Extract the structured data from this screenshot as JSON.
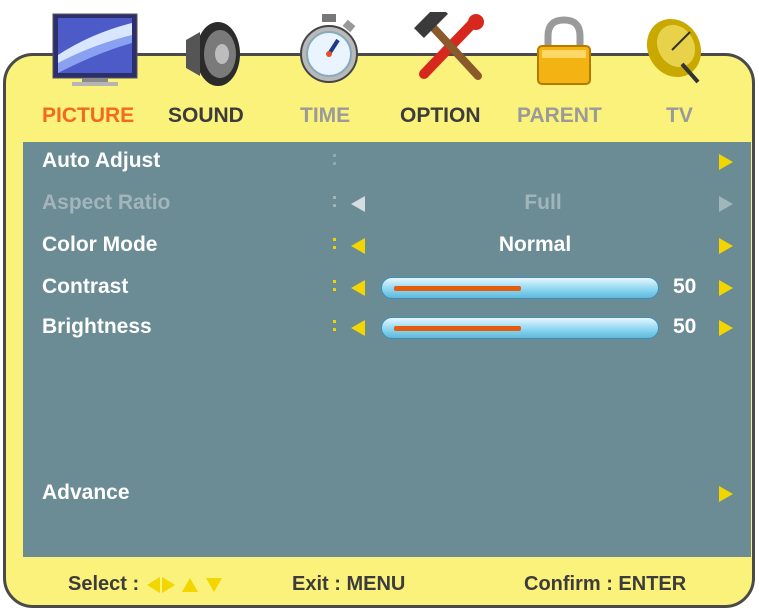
{
  "tabs": [
    {
      "label": "PICTURE",
      "icon": "monitor-icon",
      "active": true,
      "color": "#f26a1b"
    },
    {
      "label": "SOUND",
      "icon": "speaker-icon",
      "active": false,
      "color": "#3c3c3c"
    },
    {
      "label": "TIME",
      "icon": "stopwatch-icon",
      "active": false,
      "color": "#9a9a9a"
    },
    {
      "label": "OPTION",
      "icon": "tools-icon",
      "active": false,
      "color": "#3c3c3c"
    },
    {
      "label": "PARENT",
      "icon": "padlock-icon",
      "active": false,
      "color": "#9a9a9a"
    },
    {
      "label": "TV",
      "icon": "satellite-dish-icon",
      "active": false,
      "color": "#9a9a9a"
    }
  ],
  "menu": {
    "items": [
      {
        "label": "Auto Adjust",
        "colon": ":",
        "enabled": true
      },
      {
        "label": "Aspect Ratio",
        "colon": ":",
        "value": "Full",
        "enabled": false
      },
      {
        "label": "Color Mode",
        "colon": ":",
        "value": "Normal",
        "enabled": true
      },
      {
        "label": "Contrast",
        "colon": ":",
        "value": "50",
        "level": 50,
        "enabled": true
      },
      {
        "label": "Brightness",
        "colon": ":",
        "value": "50",
        "level": 50,
        "enabled": true
      },
      {
        "label": "Advance",
        "enabled": true
      }
    ]
  },
  "footer": {
    "select_label": "Select :",
    "exit_label": "Exit : MENU",
    "confirm_label": "Confirm : ENTER"
  },
  "colors": {
    "frame": "#faf27a",
    "panel": "#6b8c94",
    "arrow": "#f3d500",
    "slider_fill": "#e35c10",
    "active_tab": "#f26a1b"
  }
}
